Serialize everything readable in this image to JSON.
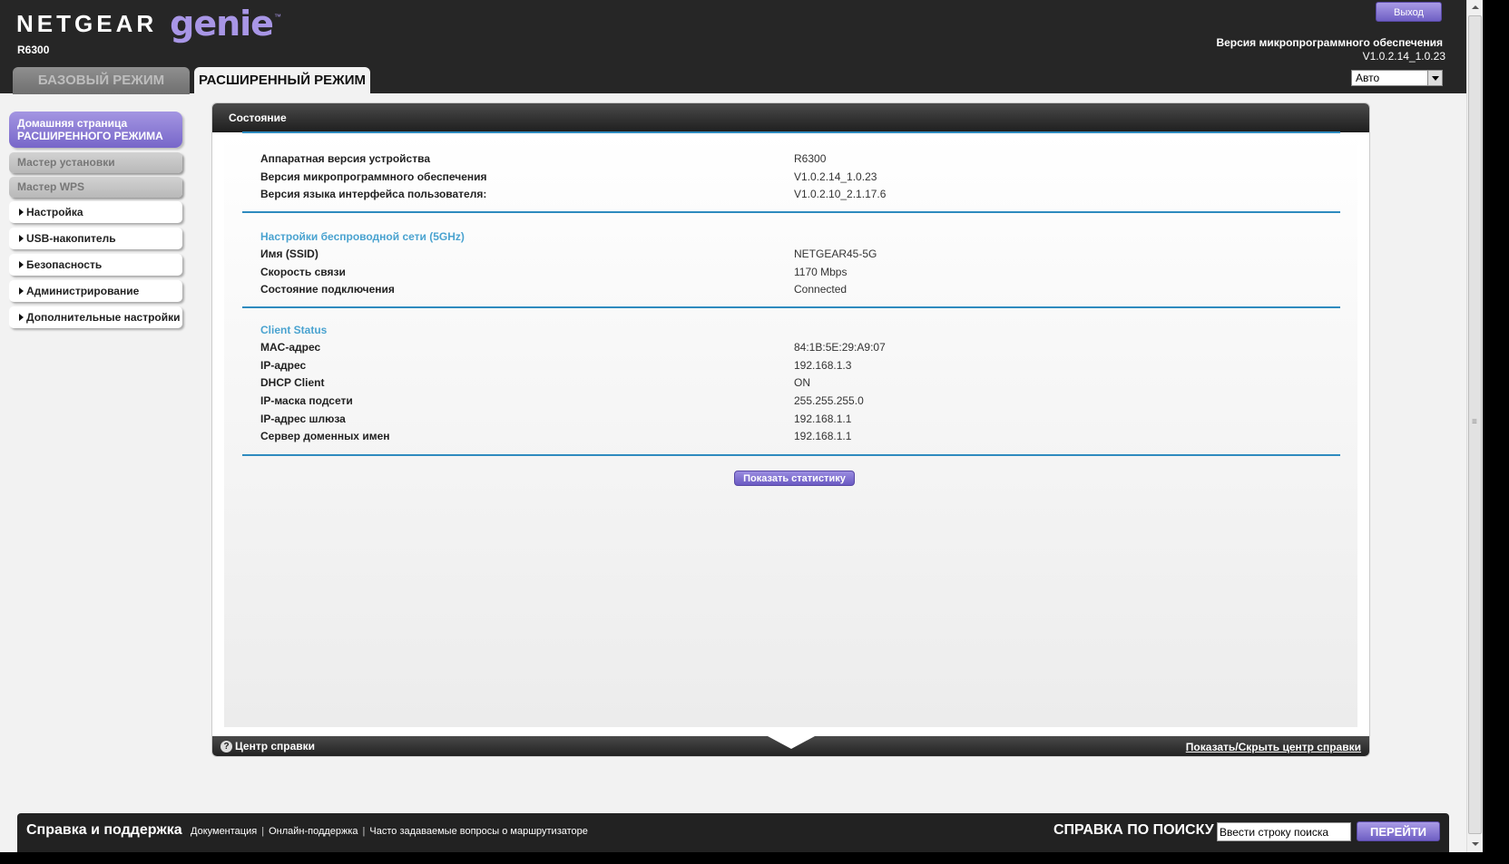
{
  "header": {
    "brand": "NETGEAR",
    "product": "genie",
    "model": "R6300",
    "logout_label": "Выход",
    "firmware_label": "Версия микропрограммного обеспечения",
    "firmware_value": "V1.0.2.14_1.0.23",
    "language_selected": "Авто",
    "tabs": [
      {
        "label": "БАЗОВЫЙ РЕЖИМ",
        "active": false
      },
      {
        "label": "РАСШИРЕННЫЙ РЕЖИМ",
        "active": true
      }
    ]
  },
  "sidebar": {
    "home_label": "Домашняя страница РАСШИРЕННОГО РЕЖИМА",
    "gray_items": [
      "Мастер установки",
      "Мастер WPS"
    ],
    "items": [
      "Настройка",
      "USB-накопитель",
      "Безопасность",
      "Администрирование",
      "Дополнительные настройки"
    ]
  },
  "panel": {
    "title": "Состояние",
    "device": [
      {
        "label": "Аппаратная версия устройства",
        "value": "R6300"
      },
      {
        "label": "Версия микропрограммного обеспечения",
        "value": "V1.0.2.14_1.0.23"
      },
      {
        "label": "Версия языка интерфейса пользователя:",
        "value": "V1.0.2.10_2.1.17.6"
      }
    ],
    "wireless_title": "Настройки беспроводной сети (5GHz)",
    "wireless": [
      {
        "label": "Имя (SSID)",
        "value": "NETGEAR45-5G"
      },
      {
        "label": "Скорость связи",
        "value": "1170 Mbps"
      },
      {
        "label": "Состояние подключения",
        "value": "Connected"
      }
    ],
    "client_title": "Client Status",
    "client": [
      {
        "label": "MAC-адрес",
        "value": "84:1B:5E:29:A9:07"
      },
      {
        "label": "IP-адрес",
        "value": "192.168.1.3"
      },
      {
        "label": "DHCP Client",
        "value": "ON"
      },
      {
        "label": "IP-маска подсети",
        "value": "255.255.255.0"
      },
      {
        "label": "IP-адрес шлюза",
        "value": "192.168.1.1"
      },
      {
        "label": "Сервер доменных имен",
        "value": "192.168.1.1"
      }
    ],
    "stats_button": "Показать статистику",
    "help_center_label": "Центр справки",
    "help_toggle_label": "Показать/Скрыть центр справки"
  },
  "bottom": {
    "support_title": "Справка и поддержка",
    "links": [
      "Документация",
      "Онлайн-поддержка",
      "Часто задаваемые вопросы о маршрутизаторе"
    ],
    "search_label": "СПРАВКА ПО ПОИСКУ",
    "search_placeholder": "Ввести строку поиска",
    "go_label": "ПЕРЕЙТИ"
  },
  "colors": {
    "accent": "#7766c9",
    "section_title": "#4aa3d0",
    "divider": "#2e8bbf",
    "header_bg": "#262626"
  }
}
